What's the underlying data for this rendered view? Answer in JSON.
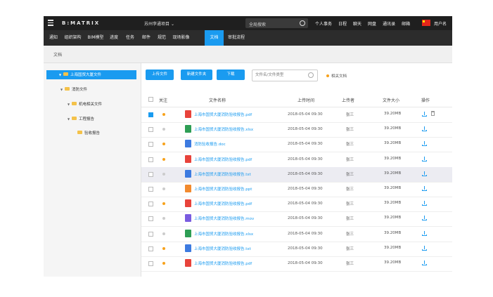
{
  "topbar": {
    "brand": "B:MATRIX",
    "project": "苏州李通项目",
    "search_placeholder": "全局搜索",
    "links": [
      "个人事务",
      "日程",
      "聊天",
      "网盘",
      "通讯录",
      "邮箱"
    ],
    "username": "用户名"
  },
  "nav": [
    "通知",
    "组织架构",
    "BIM模型",
    "进度",
    "任务",
    "邮件",
    "规范",
    "现场影像",
    "文档",
    "审批流程"
  ],
  "nav_active": "文档",
  "breadcrumb": "文档",
  "tree": [
    "上海国贸大厦文件",
    "消防文件",
    "机电相关文件",
    "工程报告",
    "验收报告"
  ],
  "toolbar": {
    "upload": "上传文件",
    "new_folder": "新建文件夹",
    "download": "下载",
    "search_placeholder": "文件名/文件类型",
    "related": "相关文档"
  },
  "table": {
    "headers": [
      "关注",
      "文件名称",
      "上传时间",
      "上传者",
      "文件大小",
      "操作"
    ],
    "rows": [
      {
        "name": "上海市国贸大厦消防验收报告.pdf",
        "type": "pdf",
        "time": "2018-05-04  09:30",
        "user": "张三",
        "size": "39.20MB",
        "checked": true,
        "star": true,
        "highlight": false
      },
      {
        "name": "上海市国贸大厦消防验收报告.xlsx",
        "type": "xlsx",
        "time": "2018-05-04  09:30",
        "user": "张三",
        "size": "39.20MB",
        "checked": false,
        "star": false,
        "highlight": false
      },
      {
        "name": "消防验收报告.doc",
        "type": "doc",
        "time": "2018-05-04  09:30",
        "user": "张三",
        "size": "39.20MB",
        "checked": false,
        "star": true,
        "highlight": false
      },
      {
        "name": "上海市国贸大厦消防验收报告.pdf",
        "type": "pdf",
        "time": "2018-05-04  09:30",
        "user": "张三",
        "size": "39.20MB",
        "checked": false,
        "star": true,
        "highlight": false
      },
      {
        "name": "上海市国贸大厦消防验收报告.txt",
        "type": "txt",
        "time": "2018-05-04  09:30",
        "user": "张三",
        "size": "39.20MB",
        "checked": false,
        "star": false,
        "highlight": true
      },
      {
        "name": "上海市国贸大厦消防验收报告.ppt",
        "type": "ppt",
        "time": "2018-05-04  09:30",
        "user": "张三",
        "size": "39.20MB",
        "checked": false,
        "star": false,
        "highlight": false
      },
      {
        "name": "上海市国贸大厦消防验收报告.pdf",
        "type": "pdf",
        "time": "2018-05-04  09:30",
        "user": "张三",
        "size": "39.20MB",
        "checked": false,
        "star": true,
        "highlight": false
      },
      {
        "name": "上海市国贸大厦消防验收报告.mov",
        "type": "mov",
        "time": "2018-05-04  09:30",
        "user": "张三",
        "size": "39.20MB",
        "checked": false,
        "star": false,
        "highlight": false
      },
      {
        "name": "上海市国贸大厦消防验收报告.xlsx",
        "type": "xlsx",
        "time": "2018-05-04  09:30",
        "user": "张三",
        "size": "39.20MB",
        "checked": false,
        "star": false,
        "highlight": false
      },
      {
        "name": "上海市国贸大厦消防验收报告.txt",
        "type": "txt",
        "time": "2018-05-04  09:30",
        "user": "张三",
        "size": "39.20MB",
        "checked": false,
        "star": true,
        "highlight": false
      },
      {
        "name": "上海市国贸大厦消防验收报告.pdf",
        "type": "pdf",
        "time": "2018-05-04  09:30",
        "user": "张三",
        "size": "39.20MB",
        "checked": false,
        "star": true,
        "highlight": false
      }
    ]
  },
  "file_colors": {
    "pdf": "#e8433b",
    "xlsx": "#2e9e55",
    "doc": "#3d7be0",
    "txt": "#3d7be0",
    "ppt": "#f28a2e",
    "mov": "#7a5ce0"
  },
  "colors": {
    "accent": "#1a9bf0",
    "topbar": "#1f1f1f",
    "navbar": "#2c2c2c",
    "star": "#f7a21b"
  }
}
